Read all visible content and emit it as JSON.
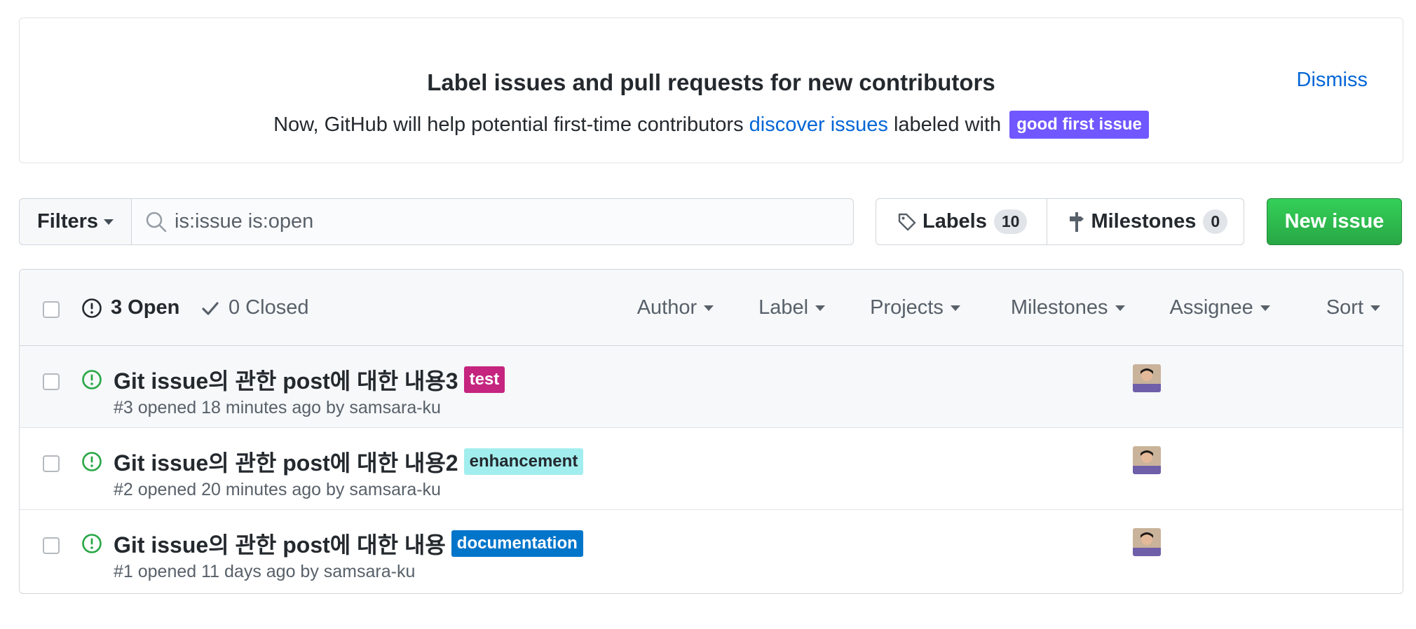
{
  "banner": {
    "title": "Label issues and pull requests for new contributors",
    "text_before": "Now, GitHub will help potential first-time contributors ",
    "link": "discover issues",
    "text_after": " labeled with ",
    "label": "good first issue",
    "label_color": "#7057ff",
    "dismiss": "Dismiss"
  },
  "toolbar": {
    "filters": "Filters",
    "search_value": "is:issue is:open",
    "labels": {
      "label": "Labels",
      "count": "10"
    },
    "milestones": {
      "label": "Milestones",
      "count": "0"
    },
    "new_issue": "New issue"
  },
  "header": {
    "open": "3 Open",
    "closed": "0 Closed",
    "menus": [
      "Author",
      "Label",
      "Projects",
      "Milestones",
      "Assignee",
      "Sort"
    ]
  },
  "issues": [
    {
      "title": "Git issue의 관한 post에 대한 내용3",
      "label": "test",
      "label_bg": "#c5247f",
      "label_fg": "#ffffff",
      "meta": "#3 opened 18 minutes ago by samsara-ku"
    },
    {
      "title": "Git issue의 관한 post에 대한 내용2",
      "label": "enhancement",
      "label_bg": "#a2eeef",
      "label_fg": "#24292e",
      "meta": "#2 opened 20 minutes ago by samsara-ku"
    },
    {
      "title": "Git issue의 관한 post에 대한 내용",
      "label": "documentation",
      "label_bg": "#0075ca",
      "label_fg": "#ffffff",
      "meta": "#1 opened 11 days ago by samsara-ku"
    }
  ],
  "colors": {
    "link": "#0366d6",
    "open_icon": "#28a745",
    "primary_button": "#2ea44f"
  }
}
